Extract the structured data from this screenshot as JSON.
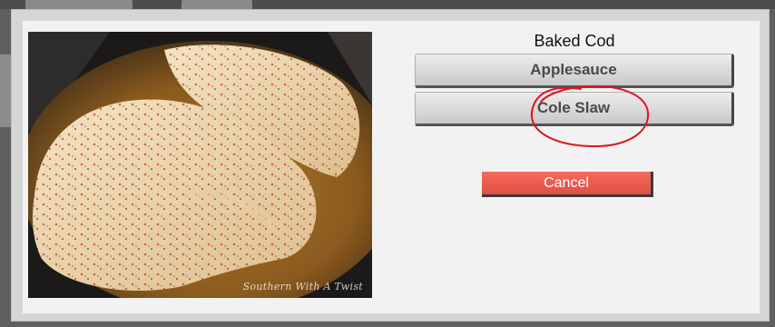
{
  "dialog": {
    "title": "Baked Cod",
    "options": [
      {
        "label": "Applesauce"
      },
      {
        "label": "Cole Slaw"
      }
    ],
    "cancel_label": "Cancel",
    "photo": {
      "watermark": "Southern With A Twist"
    }
  },
  "colors": {
    "cancel": "#e85a4f",
    "annotation_circle": "#e0141f"
  }
}
